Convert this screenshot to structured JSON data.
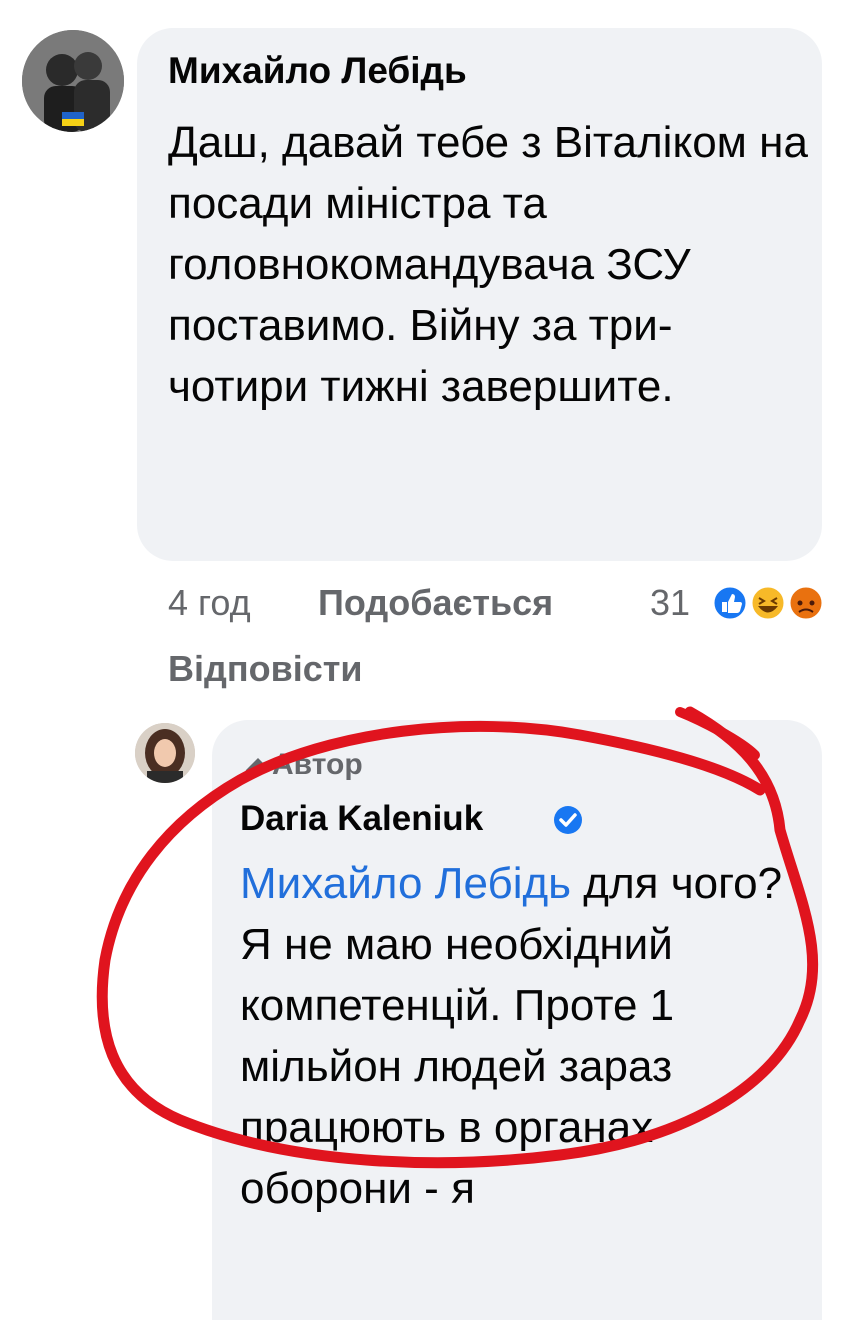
{
  "comment1": {
    "author": "Михайло Лебідь",
    "text": "Даш, давай тебе з Віталіком на посади міністра та головнокомандувача ЗСУ поставимо. Війну за три-чотири тижні завершите.",
    "time": "4 год",
    "like_label": "Подобається",
    "reply_label": "Відповісти",
    "reaction_count": "31",
    "reactions": [
      "like-icon",
      "haha-icon",
      "angry-icon"
    ]
  },
  "comment2": {
    "role_label": "Автор",
    "author": "Daria Kaleniuk",
    "mention": "Михайло Лебідь",
    "text": " для чого? Я не маю необхідний компетенцій. Проте 1 мільйон людей зараз працюють в органах оборони - я"
  },
  "colors": {
    "bubble_bg": "#f0f2f5",
    "mention": "#216fdb",
    "meta": "#65676b",
    "annotation": "#e0141e"
  }
}
